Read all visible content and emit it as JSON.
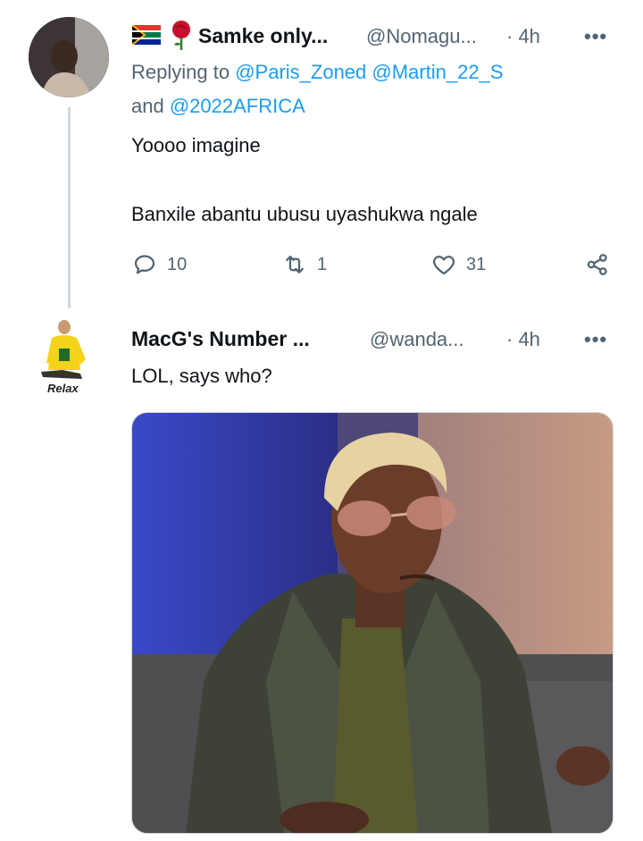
{
  "tweet1": {
    "name": "Samke only...",
    "handle": "@Nomagu...",
    "time": "· 4h",
    "more": "•••",
    "replying_prefix": "Replying to",
    "mentions_line1": "@Paris_Zoned @Martin_22_S",
    "connector": "and",
    "mention_line2": "@2022AFRICA",
    "text_line1": "Yoooo imagine",
    "text_line2": "Banxile abantu ubusu uyashukwa ngale",
    "reply_count": "10",
    "retweet_count": "1",
    "like_count": "31"
  },
  "tweet2": {
    "name": "MacG's Number ...",
    "handle": "@wanda...",
    "time": "· 4h",
    "more": "•••",
    "text": "LOL, says who?",
    "avatar_caption": "Relax"
  },
  "icons": [
    "south-africa-flag-icon",
    "rose-icon",
    "reply-icon",
    "retweet-icon",
    "like-icon",
    "share-icon"
  ],
  "colors": {
    "accent": "#1d9bf0",
    "muted": "#536471",
    "text": "#0f1419"
  }
}
